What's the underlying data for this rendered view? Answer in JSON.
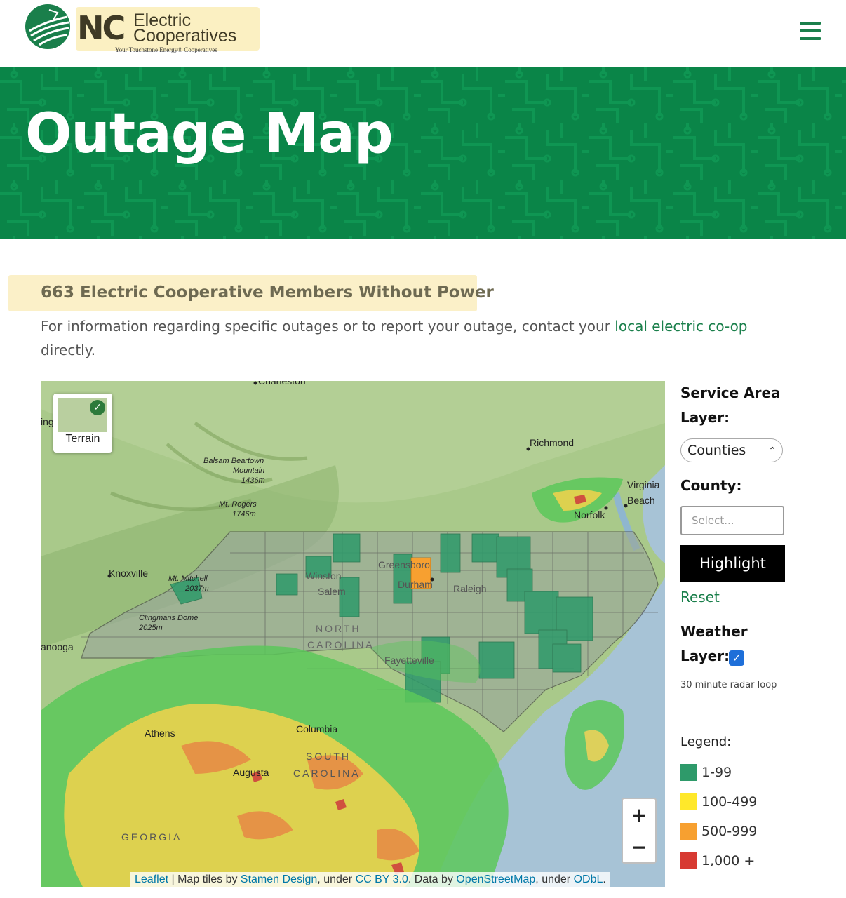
{
  "header": {
    "logo_nc": "NC",
    "logo_line1": "Electric",
    "logo_line2": "Cooperatives",
    "tagline": "Your Touchstone Energy® Cooperatives",
    "menu_icon": "hamburger-menu-icon"
  },
  "hero": {
    "title": "Outage Map"
  },
  "summary": {
    "members_without_power": "663 Electric Cooperative Members Without Power",
    "info_prefix": "For information regarding specific outages or to report your outage, contact your ",
    "info_link": "local electric co-op",
    "info_suffix": "directly."
  },
  "map": {
    "terrain_label": "Terrain",
    "zoom_in": "+",
    "zoom_out": "−",
    "attribution": {
      "leaflet": "Leaflet",
      "sep": " | Map tiles by ",
      "stamen": "Stamen Design",
      "under1": ", under ",
      "ccby": "CC BY 3.0",
      "data_by": ". Data by ",
      "osm": "OpenStreetMap",
      "under2": ", under ",
      "odbl": "ODbL",
      "end": "."
    },
    "labels": {
      "charleston": "Charleston",
      "richmond": "Richmond",
      "virginia_beach_1": "Virginia",
      "virginia_beach_2": "Beach",
      "norfolk": "Norfolk",
      "knoxville": "Knoxville",
      "chattanooga": "anooga",
      "balsam_1": "Balsam Beartown",
      "balsam_2": "Mountain",
      "balsam_3": "1436m",
      "mtrogers_1": "Mt. Rogers",
      "mtrogers_2": "1746m",
      "mitchell_1": "Mt. Mitchell",
      "mitchell_2": "2037m",
      "clingmans_1": "Clingmans Dome",
      "clingmans_2": "2025m",
      "greensboro": "Greensboro",
      "durham": "Durham",
      "raleigh": "Raleigh",
      "winston_1": "Winston",
      "winston_2": "Salem",
      "athens": "Athens",
      "columbia": "Columbia",
      "augusta": "Augusta",
      "south_carolina_1": "SOUTH",
      "south_carolina_2": "CAROLINA",
      "north_carolina_1": "NORTH",
      "north_carolina_2": "CAROLINA",
      "georgia": "GEORGIA",
      "fayetteville": "Fayetteville",
      "left_edge": "ing"
    },
    "colors": {
      "tier1": "#2e9a6a",
      "tier2": "#ffe82a",
      "tier3": "#f7a030",
      "tier4": "#d73a32"
    }
  },
  "sidebar": {
    "service_area_label_1": "Service Area",
    "service_area_label_2": "Layer:",
    "service_area_value": "Counties",
    "county_label": "County:",
    "county_placeholder": "Select...",
    "highlight_button": "Highlight",
    "reset_link": "Reset",
    "weather_label_1": "Weather",
    "weather_label_2": "Layer:",
    "weather_checked": true,
    "radar_note": "30 minute radar loop",
    "legend_title": "Legend:",
    "legend": [
      {
        "label": "1-99",
        "color": "#2e9a6a"
      },
      {
        "label": "100-499",
        "color": "#ffe82a"
      },
      {
        "label": "500-999",
        "color": "#f7a030"
      },
      {
        "label": "1,000 +",
        "color": "#d73a32"
      }
    ]
  }
}
